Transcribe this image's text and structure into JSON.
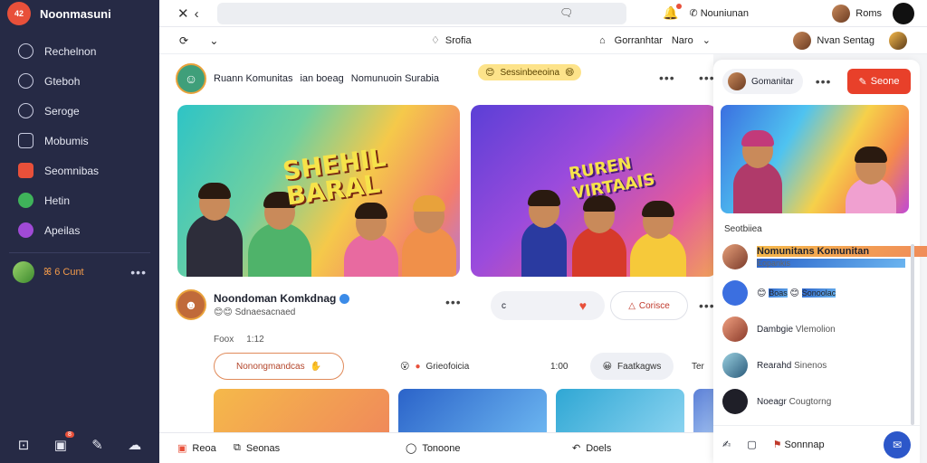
{
  "app": {
    "brand": "Noonmasuni",
    "badge": "42"
  },
  "sidebar": {
    "items": [
      {
        "label": "Rechelnon",
        "icon": "home-icon",
        "color": ""
      },
      {
        "label": "Gteboh",
        "icon": "globe-icon",
        "color": ""
      },
      {
        "label": "Seroge",
        "icon": "chat-icon",
        "color": ""
      },
      {
        "label": "Mobumis",
        "icon": "store-icon",
        "color": ""
      },
      {
        "label": "Seomnibas",
        "icon": "community-icon",
        "color": "#e8503a"
      },
      {
        "label": "Hetin",
        "icon": "leaf-icon",
        "color": "#3fb35a"
      },
      {
        "label": "Apeilas",
        "icon": "star-icon",
        "color": "#a04ad6"
      }
    ],
    "user": {
      "label": "ꕤ 6 Cunt"
    },
    "bottom_badge": "8"
  },
  "topbar": {
    "back": "✕",
    "forward": "‹",
    "url_icon": "🗨",
    "notif_label": "Nouniunan",
    "profile_name": "Roms"
  },
  "toolbar": {
    "left": "⟳ ⌄",
    "center_label": "Srofia",
    "right_label1": "Gorranhtar",
    "right_label2": "Naro",
    "profile_label": "Nvan Sentag"
  },
  "feed": {
    "post1": {
      "author": "Ruann Komunitas",
      "meta": "ian boeag",
      "subtitle": "Nomunuoin Surabia",
      "pill": "Sessinbeeoina"
    },
    "banner1_title": [
      "SHEHIL",
      "BARAL"
    ],
    "banner2_title": [
      "RUREN",
      "VIRTAAIS"
    ],
    "post2": {
      "name": "Noondoman Komkdnag",
      "sub": "Sdnaesacnaed",
      "pill_a": "c",
      "pill_b": "Corisce"
    },
    "row_label": "Foox",
    "row_label_sub": "1:12",
    "chips": [
      "Nonongmandcas",
      "Grieofoicia",
      "1:00",
      "Faatkagws",
      "Ter"
    ],
    "bottom": [
      {
        "label": "Reoa",
        "icon": "red-square-icon"
      },
      {
        "label": "Seonas",
        "icon": "copy-icon"
      },
      {
        "label": "Tonoone",
        "icon": "chat-bubble-icon"
      },
      {
        "label": "Doels",
        "icon": "reply-icon"
      }
    ]
  },
  "rpanel": {
    "chip_label": "Gomanitar",
    "button_label": "Seone",
    "section": "Seotbiiea",
    "items": [
      {
        "title": "Nomunitans Komunitan",
        "sub": "Eopankis"
      },
      {
        "title": "Boas",
        "sub": "Sonoolac"
      },
      {
        "title": "Dambgie",
        "sub": "Vlemolion"
      },
      {
        "title": "Rearahd",
        "sub": "Sinenos"
      },
      {
        "title": "Noeagr",
        "sub": "Cougtorng"
      }
    ],
    "footer": {
      "label": "Sonnnap"
    }
  },
  "colors": {
    "sidebar": "#262a45",
    "accent": "#e8402a",
    "link": "#2c57c9"
  }
}
